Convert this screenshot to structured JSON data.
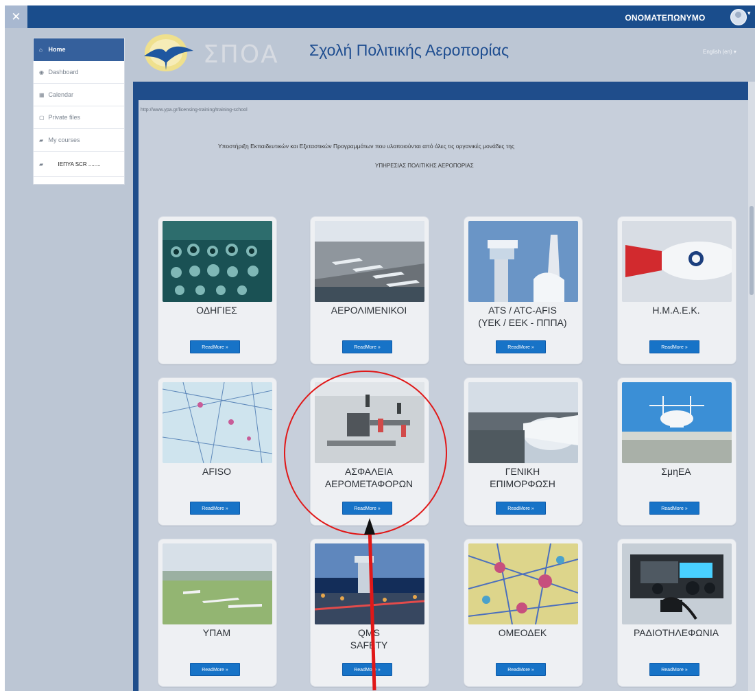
{
  "header": {
    "menu_icon": "✕",
    "user_name": "ΟΝΟΜΑΤΕΠΩΝΥΜΟ",
    "user_caret": "▾"
  },
  "brand": {
    "title": "Σχολή Πολιτικής Αεροπορίας",
    "logo_text": "ΣΠΟΑ",
    "language": "English (en) ▾"
  },
  "sidebar": {
    "items": [
      {
        "label": "Home",
        "icon": "home-icon"
      },
      {
        "label": "Dashboard",
        "icon": "dashboard-icon"
      },
      {
        "label": "Calendar",
        "icon": "calendar-icon"
      },
      {
        "label": "Private files",
        "icon": "file-icon"
      },
      {
        "label": "My courses",
        "icon": "graduation-icon"
      },
      {
        "label": "ΙΕΠΥΑ SCR ........",
        "icon": "graduation-icon"
      }
    ]
  },
  "content": {
    "url": "http://www.ypa.gr/licensing-training/training-school",
    "intro_line_1": "Υποστήριξη Εκπαιδευτικών και Εξεταστικών Προγραμμάτων που υλοποιούνται από όλες τις οργανικές μονάδες της",
    "intro_line_2": "ΥΠΗΡΕΣΙΑΣ ΠΟΛΙΤΙΚΗΣ ΑΕΡΟΠΟΡΙΑΣ",
    "readmore_label": "ReadMore »"
  },
  "cards": [
    {
      "title": "ΟΔΗΓΙΕΣ"
    },
    {
      "title": "ΑΕΡΟΛΙΜΕΝΙΚΟΙ"
    },
    {
      "title": "ATS / ATC-AFIS\n(ΥΕΚ / ΕΕΚ - ΠΠΠΑ)"
    },
    {
      "title": "Η.Μ.Α.Ε.Κ."
    },
    {
      "title": "AFISO"
    },
    {
      "title": "ΑΣΦΑΛΕΙΑ\nΑΕΡΟΜΕΤΑΦΟΡΩΝ"
    },
    {
      "title": "ΓΕΝΙΚΗ\nΕΠΙΜΟΡΦΩΣΗ"
    },
    {
      "title": "ΣμηΕΑ"
    },
    {
      "title": "ΥΠΑΜ"
    },
    {
      "title": "QMS\nSAFETY"
    },
    {
      "title": "ΟΜΕΟΔΕΚ"
    },
    {
      "title": "ΡΑΔΙΟΤΗΛΕΦΩΝΙΑ"
    }
  ],
  "colors": {
    "navy": "#1a4d8c",
    "button_blue": "#1773c7",
    "annotation_red": "#e01818"
  }
}
